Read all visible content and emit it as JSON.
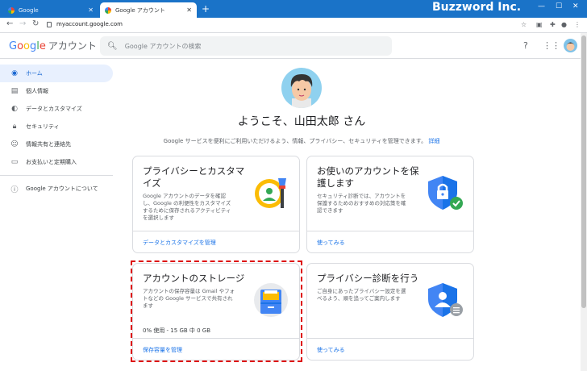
{
  "browser": {
    "tabs": [
      {
        "title": "Google"
      },
      {
        "title": "Google アカウント"
      }
    ],
    "brand": "Buzzword Inc.",
    "url": "myaccount.google.com"
  },
  "header": {
    "logo_parts": [
      "G",
      "o",
      "o",
      "g",
      "l",
      "e"
    ],
    "product": "アカウント",
    "search_placeholder": "Google アカウントの検索"
  },
  "sidebar": {
    "items": [
      {
        "label": "ホーム",
        "icon": "home-icon",
        "active": true
      },
      {
        "label": "個人情報",
        "icon": "id-card-icon"
      },
      {
        "label": "データとカスタマイズ",
        "icon": "toggle-icon"
      },
      {
        "label": "セキュリティ",
        "icon": "lock-icon"
      },
      {
        "label": "情報共有と連絡先",
        "icon": "people-icon"
      },
      {
        "label": "お支払いと定期購入",
        "icon": "credit-card-icon"
      }
    ],
    "about": {
      "label": "Google アカウントについて",
      "icon": "info-icon"
    }
  },
  "main": {
    "welcome": "ようこそ、山田太郎 さん",
    "intro": "Google サービスを便利にご利用いただけるよう、情報、プライバシー、セキュリティを管理できます。",
    "intro_link": "詳細",
    "cards": [
      {
        "title": "プライバシーとカスタマイズ",
        "desc_lines": [
          "Google アカウントのデータを確認",
          "し、Google の利便性をカスタマイズ",
          "するために保存されるアクティビティ",
          "を選択します"
        ],
        "link": "データとカスタマイズを管理"
      },
      {
        "title": "お使いのアカウントを保護します",
        "desc_lines": [
          "セキュリティ診断では、アカウントを",
          "保護するためのおすすめの対応策を確",
          "認できます"
        ],
        "link": "使ってみる"
      },
      {
        "title": "アカウントのストレージ",
        "desc_lines": [
          "アカウントの保存容量は Gmail やフォ",
          "トなどの Google サービスで共有され",
          "ます"
        ],
        "usage": "0% 使用 - 15 GB 中 0 GB",
        "link": "保存容量を管理"
      },
      {
        "title": "プライバシー診断を行う",
        "desc_lines": [
          "ご自身にあったプライバシー設定を選",
          "べるよう、順を追ってご案内します"
        ],
        "link": "使ってみる"
      }
    ]
  }
}
